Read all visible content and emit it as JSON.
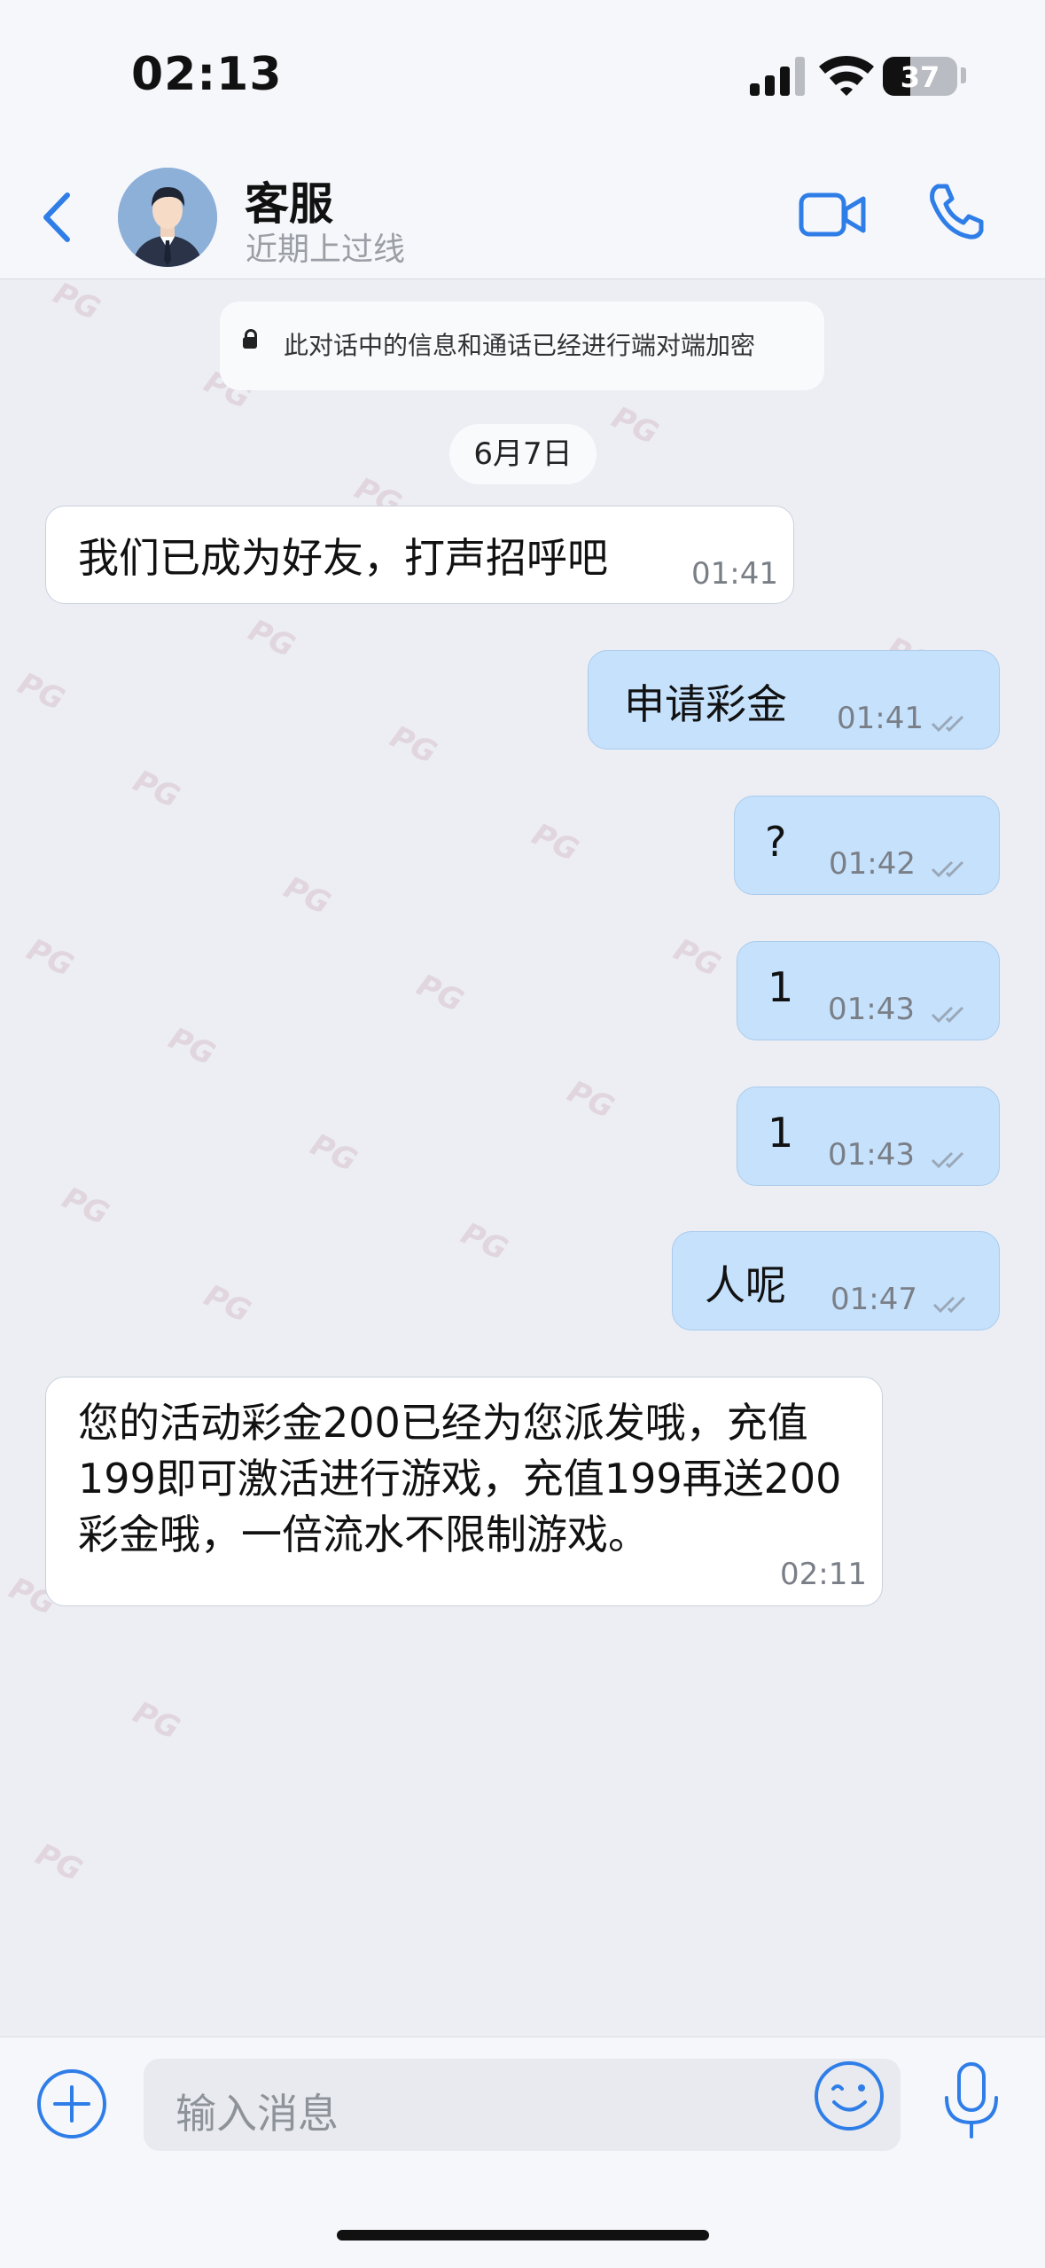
{
  "status_bar": {
    "time": "02:13",
    "battery_percent": "37",
    "battery_level": 0.37
  },
  "header": {
    "contact_name": "客服",
    "contact_status": "近期上过线"
  },
  "watermark_text": "PG",
  "notice": {
    "encryption": "此对话中的信息和通话已经进行端对端加密",
    "date": "6月7日"
  },
  "messages": [
    {
      "direction": "in",
      "text": "我们已成为好友，打声招呼吧",
      "time": "01:41"
    },
    {
      "direction": "out",
      "text": "申请彩金",
      "time": "01:41"
    },
    {
      "direction": "out",
      "text": "?",
      "time": "01:42"
    },
    {
      "direction": "out",
      "text": "1",
      "time": "01:43"
    },
    {
      "direction": "out",
      "text": "1",
      "time": "01:43"
    },
    {
      "direction": "out",
      "text": "人呢",
      "time": "01:47"
    },
    {
      "direction": "in",
      "text": "您的活动彩金200已经为您派发哦，充值199即可激活进行游戏，充值199再送200彩金哦，一倍流水不限制游戏。",
      "time": "02:11"
    }
  ],
  "input": {
    "placeholder": "输入消息"
  },
  "colors": {
    "accent": "#2f7ee8",
    "outgoing_bubble": "#c6e1fc",
    "incoming_bubble": "#ffffff",
    "background": "#eceef3"
  }
}
